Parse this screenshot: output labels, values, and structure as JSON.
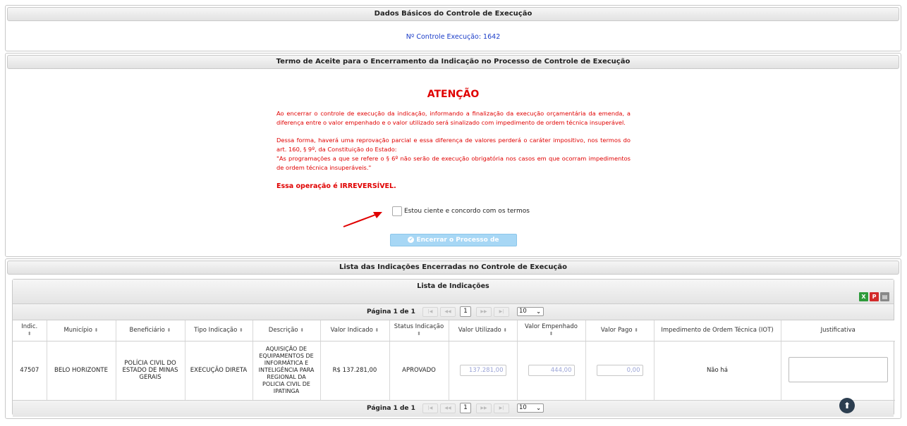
{
  "basic": {
    "header": "Dados Básicos do Controle de Execução",
    "controle_label": "Nº Controle Execução: 1642"
  },
  "termo": {
    "header": "Termo de Aceite para o Encerramento da Indicação no Processo de Controle de Execução",
    "attention": "ATENÇÃO",
    "paragraph1": "Ao encerrar o controle de execução da indicação, informando a finalização da execução orçamentária da emenda, a diferença entre o valor empenhado e o valor utilizado será sinalizado com impedimento de ordem técnica insuperável.",
    "paragraph2_line1": "Dessa forma, haverá uma reprovação parcial e essa diferença de valores perderá o caráter impositivo, nos termos do art. 160, § 9º, da Constituição do Estado:",
    "paragraph2_quote": "\"As programações a que se refere o § 6º não serão de execução obrigatória nos casos em que ocorram impedimentos de ordem técnica insuperáveis.\"",
    "irreversible": "Essa operação é IRREVERSÍVEL.",
    "agree_label": "Estou ciente e concordo com os termos",
    "button_label": "Encerrar o Processo de Execução"
  },
  "lista": {
    "header": "Lista das Indicações Encerradas no Controle de Execução",
    "title": "Lista de Indicações",
    "pagination_label": "Página 1 de 1",
    "current_page": "1",
    "rows_per_page": "10",
    "columns": [
      "Indic.",
      "Município",
      "Beneficiário",
      "Tipo Indicação",
      "Descrição",
      "Valor Indicado",
      "Status Indicação",
      "Valor Utilizado",
      "Valor Empenhado",
      "Valor Pago",
      "Impedimento de Ordem Técnica (IOT)",
      "Justificativa"
    ],
    "rows": [
      {
        "indic": "47507",
        "municipio": "BELO HORIZONTE",
        "beneficiario": "POLÍCIA CIVIL DO ESTADO DE MINAS GERAIS",
        "tipo": "EXECUÇÃO DIRETA",
        "descricao": "AQUISIÇÃO DE EQUIPAMENTOS DE INFORMÁTICA E INTELIGÊNCIA PARA REGIONAL DA POLICIA CIVIL DE IPATINGA",
        "valor_indicado": "R$ 137.281,00",
        "status": "APROVADO",
        "valor_utilizado": "137.281,00",
        "valor_empenhado": "444,00",
        "valor_pago": "0,00",
        "iot": "Não há",
        "justificativa": ""
      }
    ]
  },
  "icons": {
    "export_xls": "excel-export-icon",
    "export_pdf": "pdf-export-icon",
    "print": "print-icon",
    "scroll_top": "arrow-up-icon"
  },
  "colors": {
    "warning": "#e00000",
    "link": "#1a3cc8",
    "button_disabled": "#a7d7f5"
  }
}
